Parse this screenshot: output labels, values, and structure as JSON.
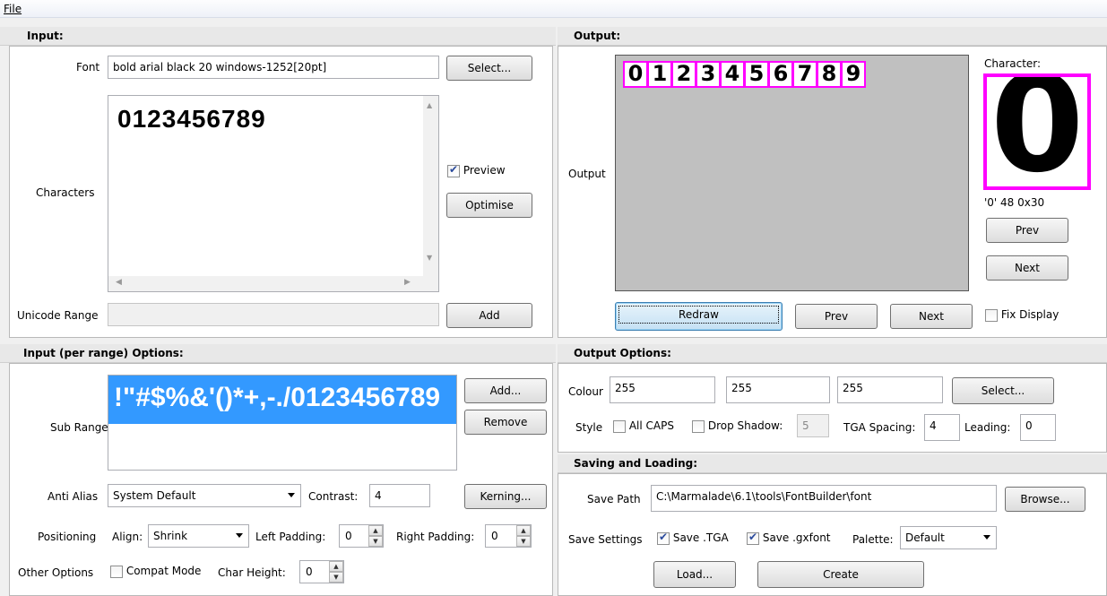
{
  "menu": {
    "file_label": "File"
  },
  "input": {
    "header": "Input:",
    "font_label": "Font",
    "font_value": "bold arial black 20 windows-1252[20pt]",
    "select_button": "Select...",
    "characters_label": "Characters",
    "characters_text": "0123456789",
    "preview_label": "Preview",
    "preview_checked": true,
    "optimise_button": "Optimise",
    "unicode_label": "Unicode Range",
    "add_button": "Add"
  },
  "output": {
    "header": "Output:",
    "output_label": "Output",
    "glyphs": [
      "0",
      "1",
      "2",
      "3",
      "4",
      "5",
      "6",
      "7",
      "8",
      "9"
    ],
    "character_label": "Character:",
    "character_glyph": "0",
    "character_info": "'0' 48 0x30",
    "prev_char_button": "Prev",
    "next_char_button": "Next",
    "redraw_button": "Redraw",
    "prev_button": "Prev",
    "next_button": "Next",
    "fix_display_label": "Fix Display"
  },
  "range_options": {
    "header": "Input (per range) Options:",
    "sub_ranges_label": "Sub Ranges",
    "sub_range_item": "!\"#$%&'()*+,-./0123456789",
    "add_button": "Add...",
    "remove_button": "Remove",
    "anti_alias_label": "Anti Alias",
    "anti_alias_value": "System Default",
    "contrast_label": "Contrast:",
    "contrast_value": "4",
    "kerning_button": "Kerning...",
    "positioning_label": "Positioning",
    "align_label": "Align:",
    "align_value": "Shrink",
    "left_padding_label": "Left Padding:",
    "left_padding_value": "0",
    "right_padding_label": "Right Padding:",
    "right_padding_value": "0",
    "other_options_label": "Other Options",
    "compat_mode_label": "Compat Mode",
    "char_height_label": "Char Height:",
    "char_height_value": "0"
  },
  "output_options": {
    "header": "Output Options:",
    "colour_label": "Colour",
    "colour_r": "255",
    "colour_g": "255",
    "colour_b": "255",
    "select_button": "Select...",
    "style_label": "Style",
    "all_caps_label": "All CAPS",
    "drop_shadow_label": "Drop Shadow:",
    "drop_shadow_value": "5",
    "tga_spacing_label": "TGA Spacing:",
    "tga_spacing_value": "4",
    "leading_label": "Leading:",
    "leading_value": "0"
  },
  "saving": {
    "header": "Saving and Loading:",
    "save_path_label": "Save Path",
    "save_path_value": "C:\\Marmalade\\6.1\\tools\\FontBuilder\\font",
    "browse_button": "Browse...",
    "save_settings_label": "Save Settings",
    "save_tga_label": "Save .TGA",
    "save_gxfont_label": "Save .gxfont",
    "palette_label": "Palette:",
    "palette_value": "Default",
    "load_button": "Load...",
    "create_button": "Create"
  }
}
